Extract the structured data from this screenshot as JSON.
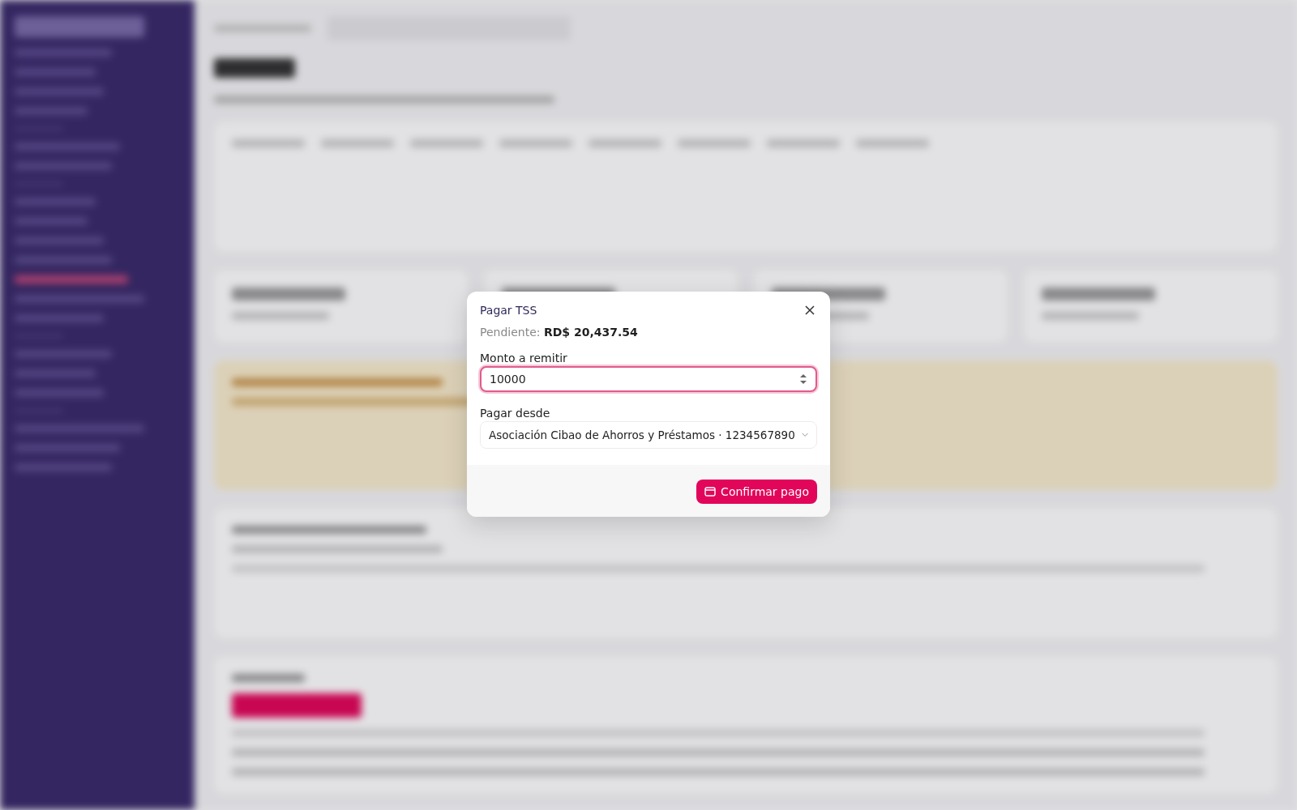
{
  "dialog": {
    "title": "Pagar TSS",
    "pending": "Pendiente: **RD$ 20,437.54**",
    "amount_field": {
      "label": "Monto a remitir",
      "value": "10000",
      "focused": true
    },
    "source_field": {
      "label": "Pagar desde",
      "value": "Asociación Cibao de Ahorros y Préstamos · 1234567890"
    },
    "confirm_button": "Confirmar pago"
  }
}
